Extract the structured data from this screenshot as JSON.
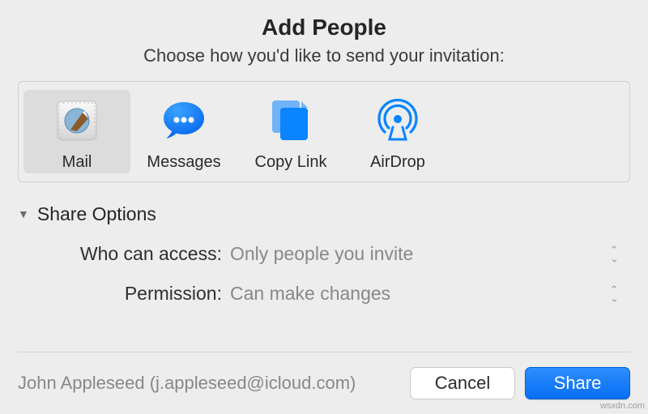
{
  "header": {
    "title": "Add People",
    "subtitle": "Choose how you'd like to send your invitation:"
  },
  "methods": {
    "selected_index": 0,
    "items": [
      {
        "id": "mail",
        "label": "Mail",
        "icon": "mail-icon"
      },
      {
        "id": "messages",
        "label": "Messages",
        "icon": "messages-icon"
      },
      {
        "id": "copylink",
        "label": "Copy Link",
        "icon": "copylink-icon"
      },
      {
        "id": "airdrop",
        "label": "AirDrop",
        "icon": "airdrop-icon"
      }
    ]
  },
  "share_options": {
    "heading": "Share Options",
    "expanded": true,
    "access_label": "Who can access:",
    "access_value": "Only people you invite",
    "permission_label": "Permission:",
    "permission_value": "Can make changes"
  },
  "footer": {
    "participant": "John Appleseed (j.appleseed@icloud.com)",
    "cancel_label": "Cancel",
    "share_label": "Share"
  },
  "watermark": "wsxdn.com"
}
